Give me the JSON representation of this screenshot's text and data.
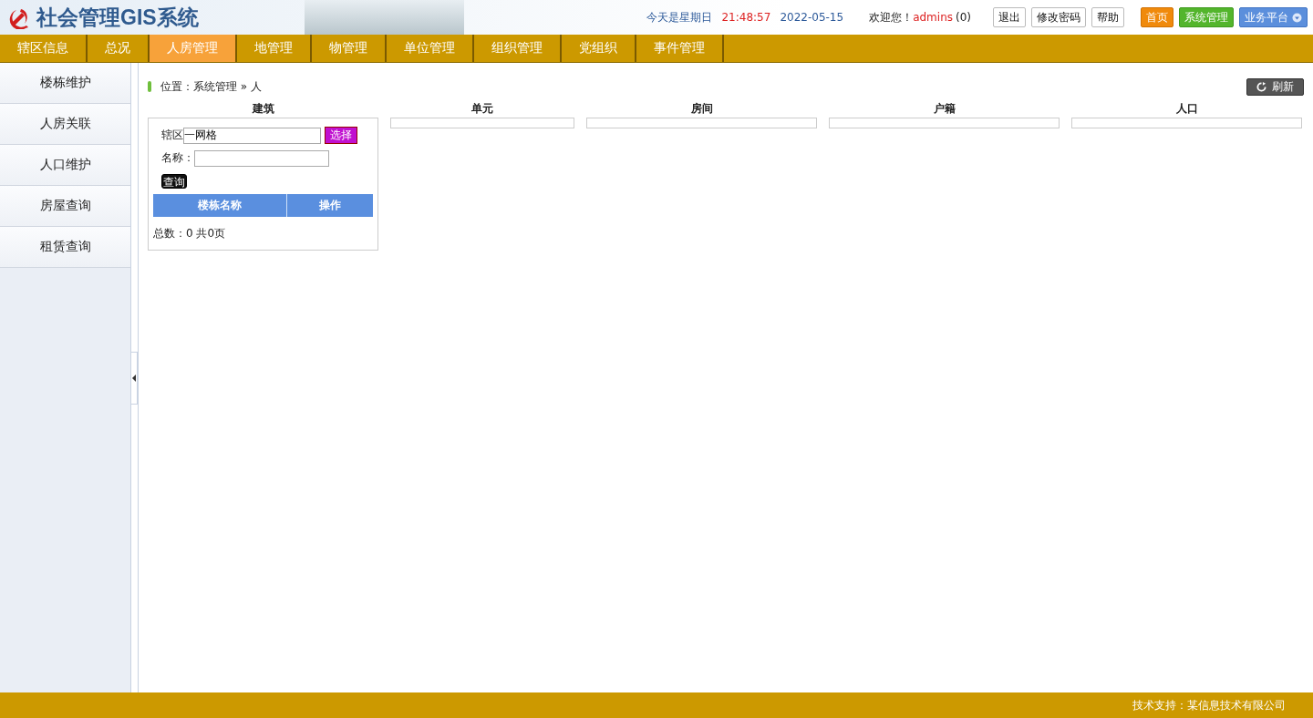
{
  "header": {
    "title": "社会管理GIS系统",
    "today": "今天是星期日",
    "time": "21:48:57",
    "date": "2022-05-15",
    "welcome": "欢迎您！",
    "user": "admins",
    "count": "(0)",
    "buttons": [
      {
        "label": "退出",
        "kind": "plain"
      },
      {
        "label": "修改密码",
        "kind": "plain"
      },
      {
        "label": "帮助",
        "kind": "plain"
      },
      {
        "label": "首页",
        "kind": "orange"
      },
      {
        "label": "系统管理",
        "kind": "green"
      },
      {
        "label": "业务平台",
        "kind": "dropdown"
      }
    ]
  },
  "tabs": [
    {
      "label": "辖区信息",
      "selected": false
    },
    {
      "label": "总况",
      "selected": false
    },
    {
      "label": "人房管理",
      "selected": true
    },
    {
      "label": "地管理",
      "selected": false
    },
    {
      "label": "物管理",
      "selected": false
    },
    {
      "label": "单位管理",
      "selected": false
    },
    {
      "label": "组织管理",
      "selected": false
    },
    {
      "label": "党组织",
      "selected": false
    },
    {
      "label": "事件管理",
      "selected": false
    }
  ],
  "sidebar": {
    "items": [
      "楼栋维护",
      "人房关联",
      "人口维护",
      "房屋查询",
      "租赁查询"
    ]
  },
  "breadcrumb": "位置：系统管理 » 人",
  "refresh": "刷新",
  "panels": [
    {
      "title": "建筑",
      "kind": "form"
    },
    {
      "title": "单元",
      "kind": "empty"
    },
    {
      "title": "房间",
      "kind": "empty"
    },
    {
      "title": "户籍",
      "kind": "empty"
    },
    {
      "title": "人口",
      "kind": "empty"
    }
  ],
  "form": {
    "district_label": "辖区",
    "district_value": "一网格",
    "select": "选择",
    "name_label": "名称：",
    "query": "查询",
    "columns": [
      "楼栋名称",
      "操作"
    ],
    "summary": "总数：0 共0页"
  },
  "footer": "技术支持：某信息技术有限公司"
}
